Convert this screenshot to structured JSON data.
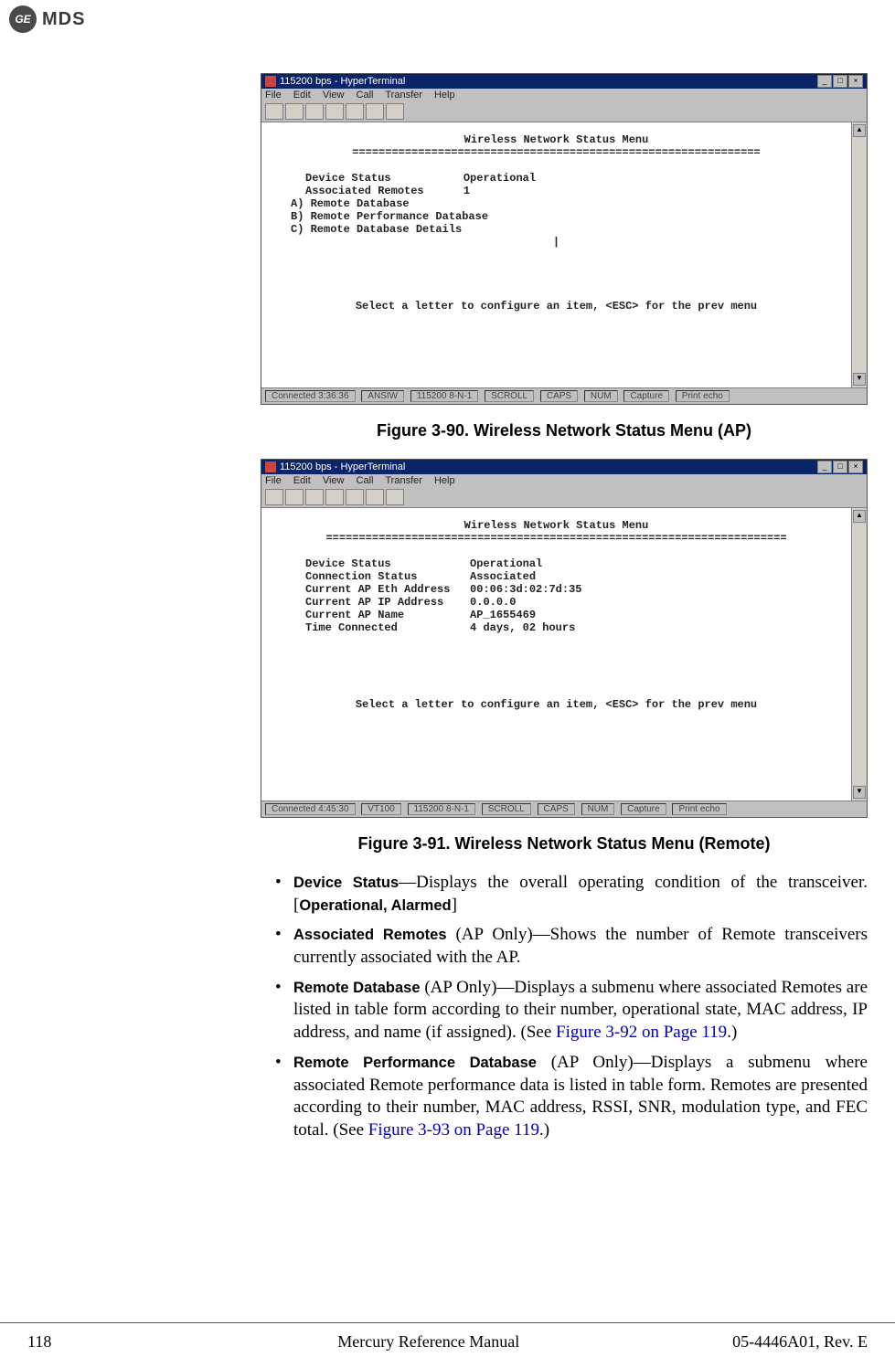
{
  "header": {
    "ge_logo_text": "GE",
    "brand": "MDS"
  },
  "figure_1": {
    "term": {
      "title": "115200 bps - HyperTerminal",
      "menubar": {
        "m1": "File",
        "m2": "Edit",
        "m3": "View",
        "m4": "Call",
        "m5": "Transfer",
        "m6": "Help"
      },
      "heading": "Wireless Network Status Menu",
      "divider": "==============================================================",
      "r1_label": "Device Status",
      "r1_val": "Operational",
      "r2_label": "Associated Remotes",
      "r2_val": "1",
      "rA": "A) Remote Database",
      "rB": "B) Remote Performance Database",
      "rC": "C) Remote Database Details",
      "cursor": "|",
      "prompt": "Select a letter to configure an item, <ESC> for the prev menu",
      "status": {
        "s1": "Connected 3:36:36",
        "s2": "ANSIW",
        "s3": "115200 8-N-1",
        "s4": "SCROLL",
        "s5": "CAPS",
        "s6": "NUM",
        "s7": "Capture",
        "s8": "Print echo"
      }
    },
    "caption": "Figure 3-90. Wireless Network Status Menu (AP)"
  },
  "figure_2": {
    "term": {
      "title": "115200 bps - HyperTerminal",
      "menubar": {
        "m1": "File",
        "m2": "Edit",
        "m3": "View",
        "m4": "Call",
        "m5": "Transfer",
        "m6": "Help"
      },
      "heading": "Wireless Network Status Menu",
      "divider": "======================================================================",
      "r1_label": "Device Status",
      "r1_val": "Operational",
      "r2_label": "Connection Status",
      "r2_val": "Associated",
      "r3_label": "Current AP Eth Address",
      "r3_val": "00:06:3d:02:7d:35",
      "r4_label": "Current AP IP Address",
      "r4_val": "0.0.0.0",
      "r5_label": "Current AP Name",
      "r5_val": "AP_1655469",
      "r6_label": "Time Connected",
      "r6_val": "4 days, 02 hours",
      "prompt": "Select a letter to configure an item, <ESC> for the prev menu",
      "status": {
        "s1": "Connected 4:45:30",
        "s2": "VT100",
        "s3": "115200 8-N-1",
        "s4": "SCROLL",
        "s5": "CAPS",
        "s6": "NUM",
        "s7": "Capture",
        "s8": "Print echo"
      }
    },
    "caption": "Figure 3-91. Wireless Network Status Menu (Remote)"
  },
  "bullets": {
    "b1": {
      "label": "Device Status",
      "dash": "—",
      "text1": "Displays the overall operating condition of the transceiver. [",
      "values": "Operational, Alarmed",
      "text2": "]"
    },
    "b2": {
      "label": "Associated Remotes",
      "rest": " (AP Only)—Shows the number of Remote transceivers currently associated with the AP."
    },
    "b3": {
      "label": "Remote Database",
      "text1": " (AP Only)—Displays a submenu where associated Remotes are listed in table form according to their number, operational state, MAC address, IP address, and name (if assigned). (See ",
      "xref": "Figure 3-92 on Page 119",
      "text2": ".)"
    },
    "b4": {
      "label": "Remote Performance Database",
      "text1": " (AP Only)—Displays a submenu where associated Remote performance data is listed in table form. Remotes are presented according to their number, MAC address, RSSI, SNR, modulation type, and FEC total. (See ",
      "xref": "Figure 3-93 on Page 119",
      "text2": ".)"
    }
  },
  "footer": {
    "left": "118",
    "center": "Mercury Reference Manual",
    "right": "05-4446A01, Rev. E"
  }
}
